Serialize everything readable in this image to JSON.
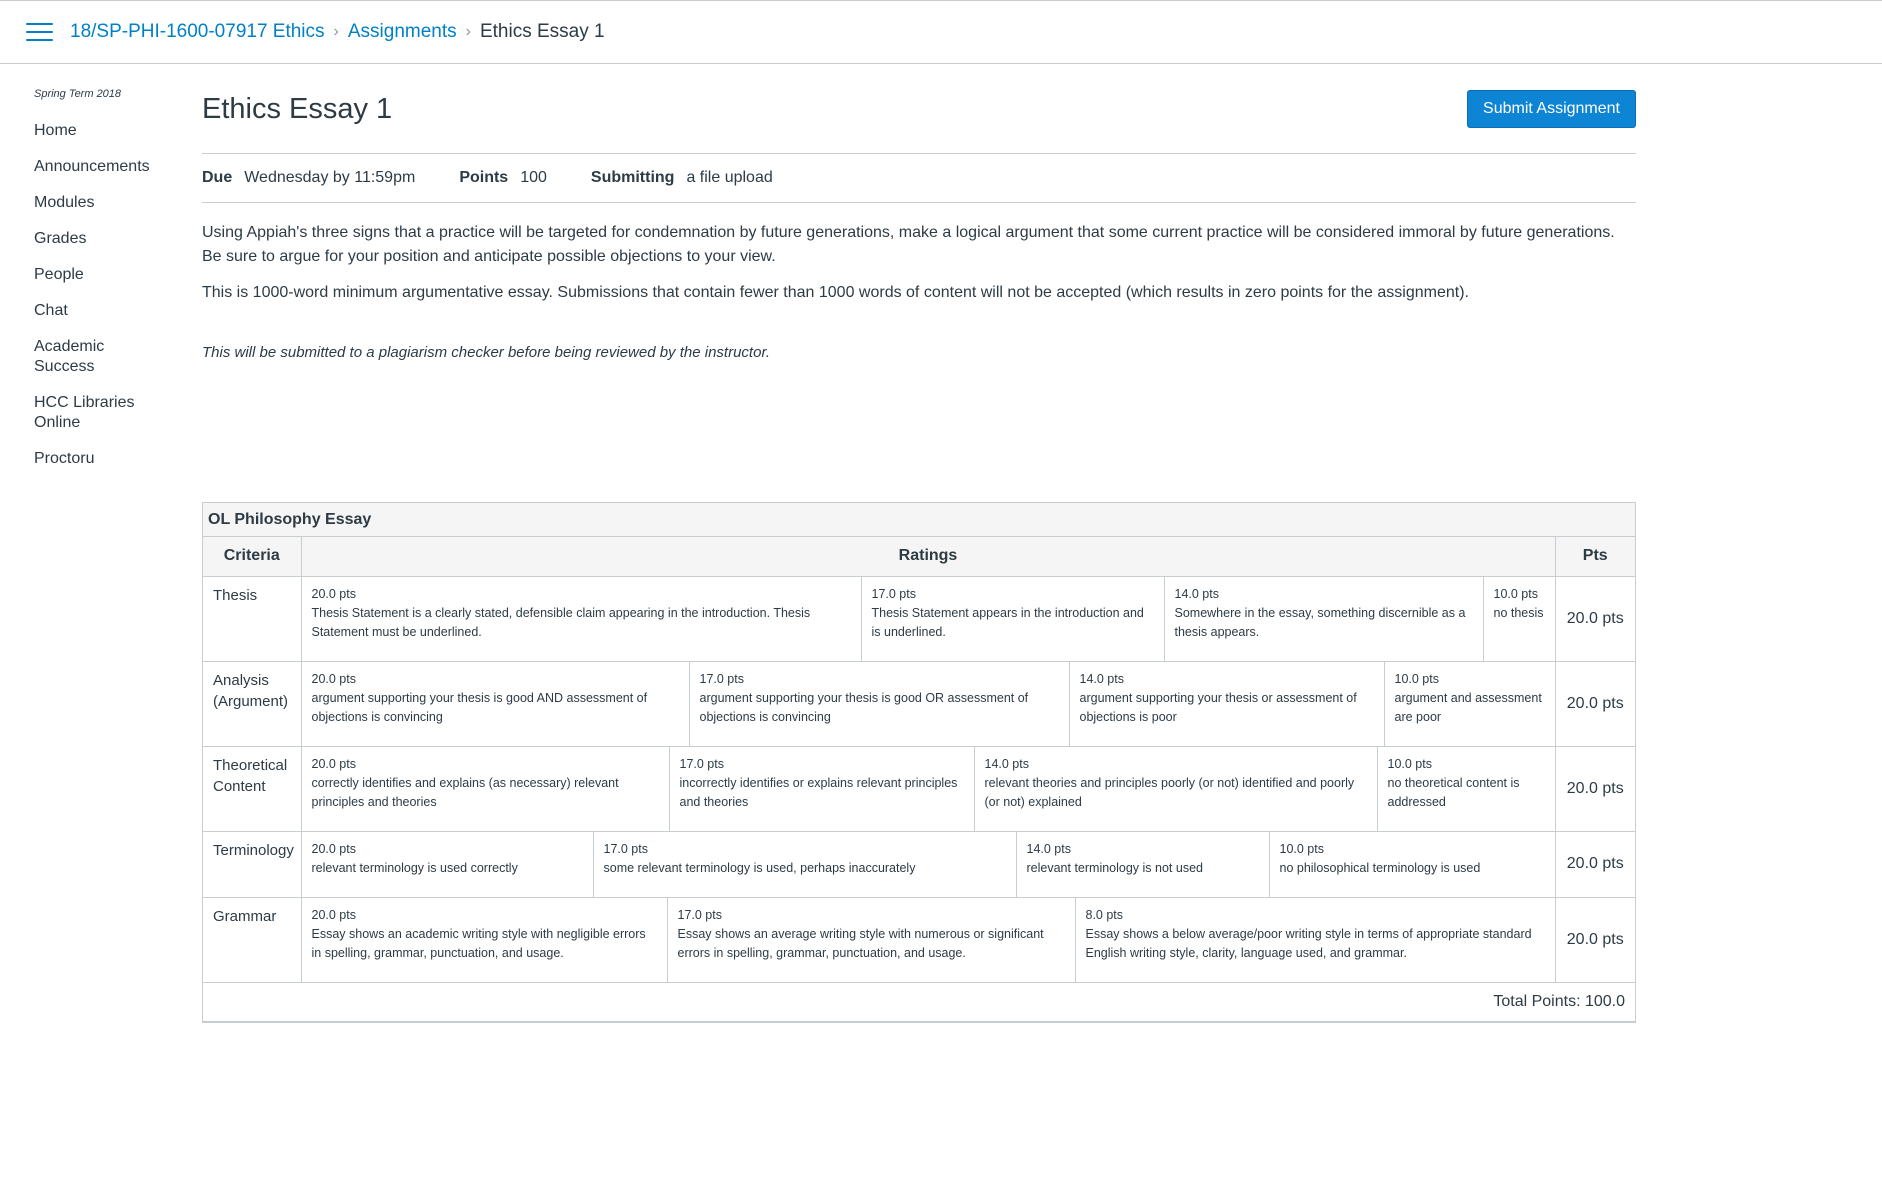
{
  "breadcrumb": {
    "course": "18/SP-PHI-1600-07917 Ethics",
    "section": "Assignments",
    "current": "Ethics Essay 1"
  },
  "sidebar": {
    "term": "Spring Term 2018",
    "items": [
      {
        "label": "Home"
      },
      {
        "label": "Announcements"
      },
      {
        "label": "Modules"
      },
      {
        "label": "Grades"
      },
      {
        "label": "People"
      },
      {
        "label": "Chat"
      },
      {
        "label": "Academic Success"
      },
      {
        "label": "HCC Libraries Online"
      },
      {
        "label": "Proctoru"
      }
    ]
  },
  "assignment": {
    "title": "Ethics Essay 1",
    "submit_label": "Submit Assignment",
    "due_label": "Due",
    "due_value": "Wednesday by 11:59pm",
    "points_label": "Points",
    "points_value": "100",
    "submitting_label": "Submitting",
    "submitting_value": "a file upload",
    "description_1": "Using Appiah's three signs that a practice will be targeted for condemnation by future generations, make a logical argument that some current practice will be considered immoral by future generations.   Be sure to argue for your position and anticipate possible objections to your view.",
    "description_2": "This is 1000-word minimum argumentative essay.  Submissions that contain fewer than 1000 words of content will not be accepted (which results in zero points for the assignment).",
    "note": "This will be submitted to a plagiarism checker before being reviewed by the instructor."
  },
  "rubric": {
    "title": "OL Philosophy Essay",
    "headers": {
      "criteria": "Criteria",
      "ratings": "Ratings",
      "pts": "Pts"
    },
    "rows": [
      {
        "criterion": "Thesis",
        "pts": "20.0 pts",
        "ratings": [
          {
            "points": "20.0 pts",
            "desc": "Thesis Statement is a clearly stated, defensible claim appearing in the introduction. Thesis Statement must be underlined."
          },
          {
            "points": "17.0 pts",
            "desc": "Thesis Statement appears in the introduction and is underlined."
          },
          {
            "points": "14.0 pts",
            "desc": "Somewhere in the essay, something discernible as a thesis appears."
          },
          {
            "points": "10.0 pts",
            "desc": "no thesis"
          }
        ]
      },
      {
        "criterion": "Analysis (Argument)",
        "pts": "20.0 pts",
        "ratings": [
          {
            "points": "20.0 pts",
            "desc": "argument supporting your thesis is good AND assessment of objections is convincing"
          },
          {
            "points": "17.0 pts",
            "desc": "argument supporting your thesis is good OR assessment of objections is convincing"
          },
          {
            "points": "14.0 pts",
            "desc": "argument supporting your thesis or assessment of objections is poor"
          },
          {
            "points": "10.0 pts",
            "desc": "argument and assessment are poor"
          }
        ]
      },
      {
        "criterion": "Theoretical Content",
        "pts": "20.0 pts",
        "ratings": [
          {
            "points": "20.0 pts",
            "desc": "correctly identifies and explains (as necessary) relevant principles and theories"
          },
          {
            "points": "17.0 pts",
            "desc": "incorrectly identifies or explains relevant principles and theories"
          },
          {
            "points": "14.0 pts",
            "desc": "relevant theories and principles poorly (or not) identified and poorly (or not) explained"
          },
          {
            "points": "10.0 pts",
            "desc": "no theoretical content is addressed"
          }
        ]
      },
      {
        "criterion": "Terminology",
        "pts": "20.0 pts",
        "ratings": [
          {
            "points": "20.0 pts",
            "desc": "relevant terminology is used correctly"
          },
          {
            "points": "17.0 pts",
            "desc": "some relevant terminology is used, perhaps inaccurately"
          },
          {
            "points": "14.0 pts",
            "desc": "relevant terminology is not used"
          },
          {
            "points": "10.0 pts",
            "desc": "no philosophical terminology is used"
          }
        ]
      },
      {
        "criterion": "Grammar",
        "pts": "20.0 pts",
        "ratings": [
          {
            "points": "20.0 pts",
            "desc": "Essay shows an academic writing style with negligible errors in spelling, grammar, punctuation, and usage."
          },
          {
            "points": "17.0 pts",
            "desc": "Essay shows an average writing style with numerous or significant errors in spelling, grammar, punctuation, and usage."
          },
          {
            "points": "8.0 pts",
            "desc": "Essay shows a below average/poor writing style in terms of appropriate standard English writing style, clarity, language used, and grammar."
          }
        ]
      }
    ],
    "total": "Total Points: 100.0"
  }
}
